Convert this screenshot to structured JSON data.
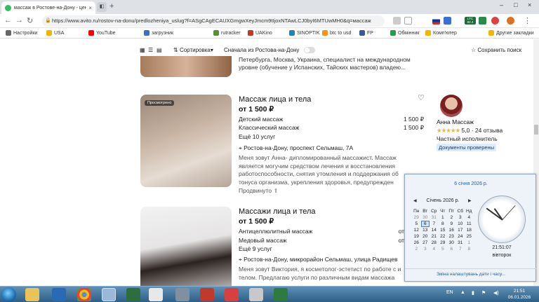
{
  "browser": {
    "tab_title": "массаж в Ростове-на-Дону - цен",
    "tab_close": "×",
    "new_tab": "+",
    "url": "https://www.avito.ru/rostov-na-donu/predlozheniya_uslug?f=ASgCAgECAUXGmgwXeyJmcm9tIjoxNTAwLCJ0byI6MTUwMH0&q=массаж",
    "ext_badge": "LTC 82.4",
    "window_controls": [
      "–",
      "□",
      "×"
    ]
  },
  "bookmarks": [
    "Настройки",
    "USA",
    "YouTube",
    "загрузник",
    "rutracker",
    "UAKino",
    "SINOPTIK",
    "btc to usd",
    "FP",
    "Обмінник",
    "Комп'ютер",
    "Другие закладки"
  ],
  "toolbar": {
    "sort_label": "Сортировка",
    "sort_chevron": "▾",
    "ros_first_label": "Сначала из Ростова-на-Дону",
    "save_search_label": "Сохранить поиск",
    "save_search_icon": "☆"
  },
  "prev_snippet": "Петербурга, Москва, Украина, специалист на международном уровне (обучение у Испанских, Тайских мастеров) владею...",
  "listings": [
    {
      "badge": "Просмотрено",
      "title": "Массаж лица и тела",
      "price": "от 1 500 ₽",
      "services": [
        {
          "name": "Детский массаж",
          "price": "1 500 ₽"
        },
        {
          "name": "Классический массаж",
          "price": "1 500 ₽"
        }
      ],
      "more": "Ещё 10 услуг",
      "address": "Ростов-на-Дону, проспект Сельмаш, 7А",
      "description": "Меня зовут Анна- дипломированный массажист. Массаж является могучим средством лечения и восстановления работоспособности, снятия утомления и поддержания об тонуса организма, укрепления здоровья, предупрежден",
      "expand": "Продвинуто"
    },
    {
      "title": "Массажи лица и тела",
      "price": "от 1 500 ₽",
      "services": [
        {
          "name": "Антицеллюлитный массаж",
          "price": "от"
        },
        {
          "name": "Медовый массаж",
          "price": "от"
        }
      ],
      "more": "Ещё 9 услуг",
      "address": "Ростов-на-Дону, микрорайон Сельмаш, улица Радищев",
      "description": "Меня зовут Виктория, я косметолог-эстетист по работе с и телом. Предлагаю услуги по различным видам массажа"
    }
  ],
  "seller": {
    "name": "Анна Массаж",
    "stars": "★★★★★",
    "rating": "5,0",
    "reviews": "· 24 отзыва",
    "type": "Частный исполнитель",
    "docs": "Документы проверены"
  },
  "calendar": {
    "date_header": "6 січня 2026 р.",
    "month": "Січень 2026 р.",
    "weekdays": [
      "Пн",
      "Вт",
      "Ср",
      "Чт",
      "Пт",
      "Сб",
      "Нд"
    ],
    "weeks": [
      [
        "29",
        "30",
        "31",
        "1",
        "2",
        "3",
        "4"
      ],
      [
        "5",
        "6",
        "7",
        "8",
        "9",
        "10",
        "11"
      ],
      [
        "12",
        "13",
        "14",
        "15",
        "16",
        "17",
        "18"
      ],
      [
        "19",
        "20",
        "21",
        "22",
        "23",
        "24",
        "25"
      ],
      [
        "26",
        "27",
        "28",
        "29",
        "30",
        "31",
        "1"
      ],
      [
        "2",
        "3",
        "4",
        "5",
        "6",
        "7",
        "8"
      ]
    ],
    "time": "21:51:07",
    "weekday": "вівторок",
    "settings_link": "Зміна налаштувань дати і часу..."
  },
  "taskbar": {
    "lang": "EN",
    "time": "21:51",
    "date": "06.01.2026"
  }
}
